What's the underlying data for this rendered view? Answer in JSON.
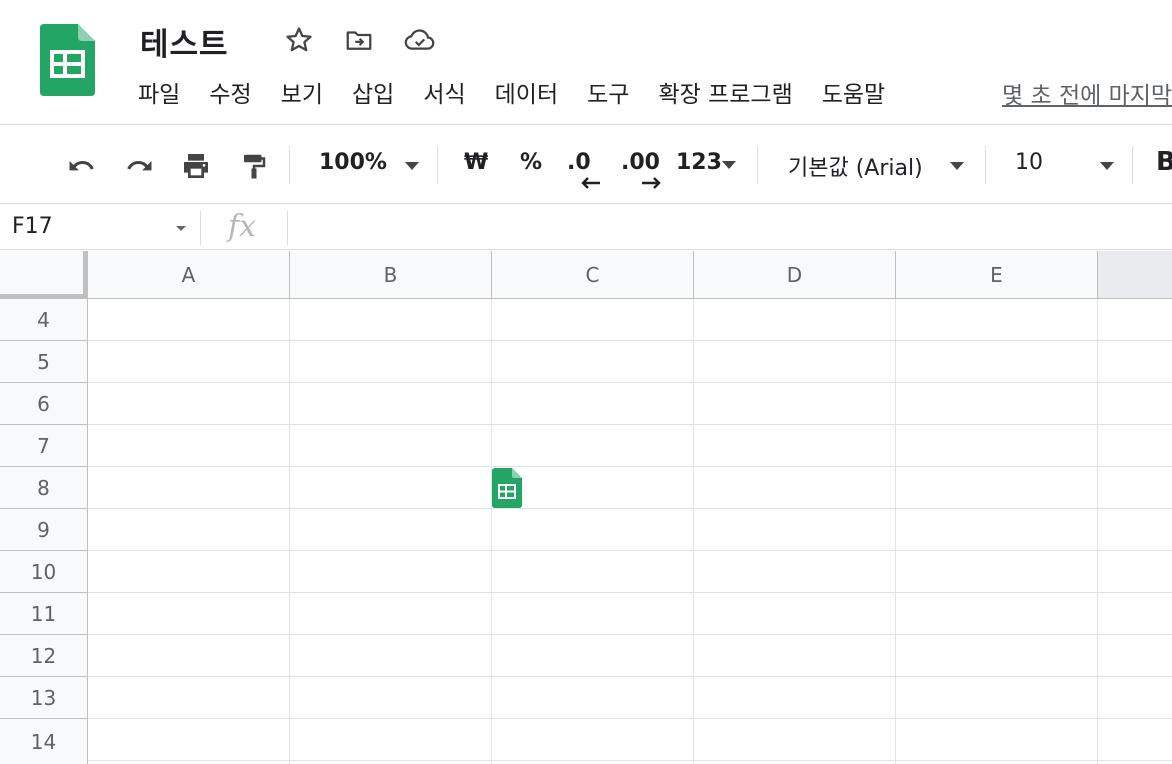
{
  "header": {
    "title": "테스트",
    "menu": [
      "파일",
      "수정",
      "보기",
      "삽입",
      "서식",
      "데이터",
      "도구",
      "확장 프로그램",
      "도움말"
    ],
    "last_edit": "몇 초 전에 마지막"
  },
  "toolbar": {
    "zoom": "100%",
    "currency": "₩",
    "percent": "%",
    "decrease_decimal": ".0",
    "increase_decimal": ".00",
    "number_format": "123",
    "font": "기본값 (Arial)",
    "font_size": "10",
    "bold": "B"
  },
  "formula_bar": {
    "cell_ref": "F17",
    "fx": "fx"
  },
  "grid": {
    "columns": [
      "A",
      "B",
      "C",
      "D",
      "E"
    ],
    "rows": [
      "4",
      "5",
      "6",
      "7",
      "8",
      "9",
      "10",
      "11",
      "12",
      "13",
      "14"
    ]
  },
  "colors": {
    "sheets_green": "#23A566",
    "gridline": "#e2e3e3",
    "header_bg": "#f8f9fa"
  }
}
